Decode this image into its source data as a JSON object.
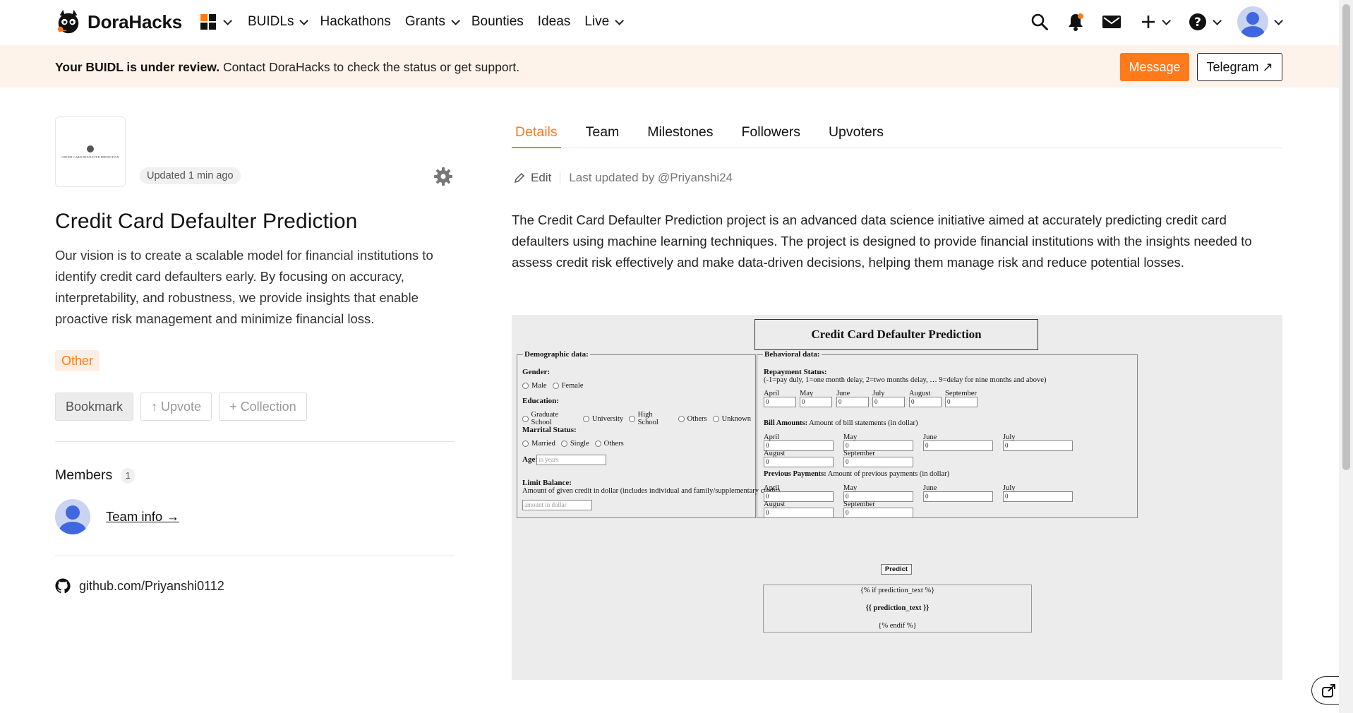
{
  "nav": {
    "brand": "DoraHacks",
    "items": [
      {
        "label": "BUIDLs",
        "dropdown": true
      },
      {
        "label": "Hackathons",
        "dropdown": false
      },
      {
        "label": "Grants",
        "dropdown": true
      },
      {
        "label": "Bounties",
        "dropdown": false
      },
      {
        "label": "Ideas",
        "dropdown": false
      },
      {
        "label": "Live",
        "dropdown": true
      }
    ],
    "icons": [
      "apps-grid-icon",
      "search-icon",
      "notification-bell-icon",
      "mail-icon",
      "plus-icon",
      "help-icon",
      "user-avatar-icon"
    ]
  },
  "banner": {
    "bold": "Your BUIDL is under review.",
    "text": " Contact DoraHacks to check the status or get support.",
    "message_button": "Message",
    "telegram_button": "Telegram ↗"
  },
  "project": {
    "logo_caption": "CREDIT CARD DEFAULTER PREDICTION",
    "updated": "Updated 1 min ago",
    "title": "Credit Card Defaulter Prediction",
    "vision": "Our vision is to create a scalable model for financial institutions to identify credit card defaulters early. By focusing on accuracy, interpretability, and robustness, we provide insights that enable proactive risk management and minimize financial loss.",
    "tag": "Other",
    "bookmark": "Bookmark",
    "upvote": "↑ Upvote",
    "collection": "+ Collection",
    "members_label": "Members",
    "members_count": "1",
    "team_info": "Team info →",
    "github": "github.com/Priyanshi0112"
  },
  "tabs": [
    "Details",
    "Team",
    "Milestones",
    "Followers",
    "Upvoters"
  ],
  "details": {
    "edit": "Edit",
    "last_updated": "Last updated by @Priyanshi24",
    "description": "The Credit Card Defaulter Prediction project is an advanced data science initiative aimed at accurately predicting credit card defaulters using machine learning techniques. The project is designed to provide financial institutions with the insights needed to assess credit risk effectively and make data-driven decisions, helping them manage risk and reduce potential losses."
  },
  "form": {
    "title": "Credit Card Defaulter Prediction",
    "demographic_legend": "Demographic data:",
    "gender_label": "Gender:",
    "gender_options": [
      "Male",
      "Female"
    ],
    "education_label": "Education:",
    "education_options": [
      "Graduate School",
      "University",
      "High School",
      "Others",
      "Unknown"
    ],
    "marital_label": "Marrital Status:",
    "marital_options": [
      "Married",
      "Single",
      "Others"
    ],
    "age_label": "Age:",
    "age_placeholder": "in years",
    "limit_label": "Limit Balance:",
    "limit_desc": "Amount of given credit in dollar (includes individual and family/supplementary credit)",
    "limit_placeholder": "amount in dollar",
    "behavioral_legend": "Behavioral data:",
    "repayment_label": "Repayment Status:",
    "repayment_desc": "(-1=pay duly, 1=one month delay, 2=two months delay, … 9=delay for nine months and above)",
    "repayment_months": [
      "April",
      "May",
      "June",
      "July",
      "August",
      "September"
    ],
    "bill_label": "Bill Amounts:",
    "bill_desc": " Amount of bill statements (in dollar)",
    "bill_months": [
      "April",
      "May",
      "June",
      "July",
      "August",
      "September"
    ],
    "prev_label": "Previous Payments:",
    "prev_desc": " Amount of previous payments (in dollar)",
    "prev_months": [
      "April",
      "May",
      "June",
      "July",
      "August",
      "September"
    ],
    "default_value": "0",
    "predict_button": "Predict",
    "pred_if": "{% if prediction_text %}",
    "pred_text": "{{ prediction_text }}",
    "pred_endif": "{% endif %}"
  },
  "colors": {
    "accent": "#ff7a1a",
    "banner_bg": "#fdf3ea",
    "avatar_blue": "#3f67e0"
  }
}
